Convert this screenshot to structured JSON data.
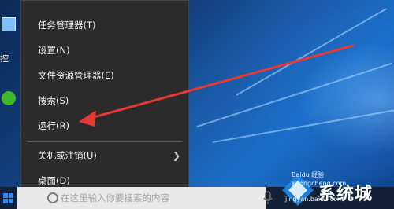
{
  "desktop": {
    "icons": [
      {
        "name": "control-panel-icon",
        "label": "控"
      },
      {
        "name": "wechat-icon",
        "label": ""
      }
    ]
  },
  "context_menu": {
    "items": [
      {
        "label": "任务管理器(T)"
      },
      {
        "label": "设置(N)"
      },
      {
        "label": "文件资源管理器(E)"
      },
      {
        "label": "搜索(S)"
      },
      {
        "label": "运行(R)"
      },
      {
        "label": "关机或注销(U)",
        "submenu": true
      },
      {
        "label": "桌面(D)"
      }
    ]
  },
  "taskbar": {
    "search_placeholder": "在这里输入你要搜索的内容"
  },
  "watermark": {
    "domain_top": "Baidu 经验",
    "domain_mid": "xitongcheng.com",
    "brand": "系统城",
    "url": "jingyan.baidu.com"
  },
  "annotation": {
    "arrow_color": "#e53935"
  }
}
